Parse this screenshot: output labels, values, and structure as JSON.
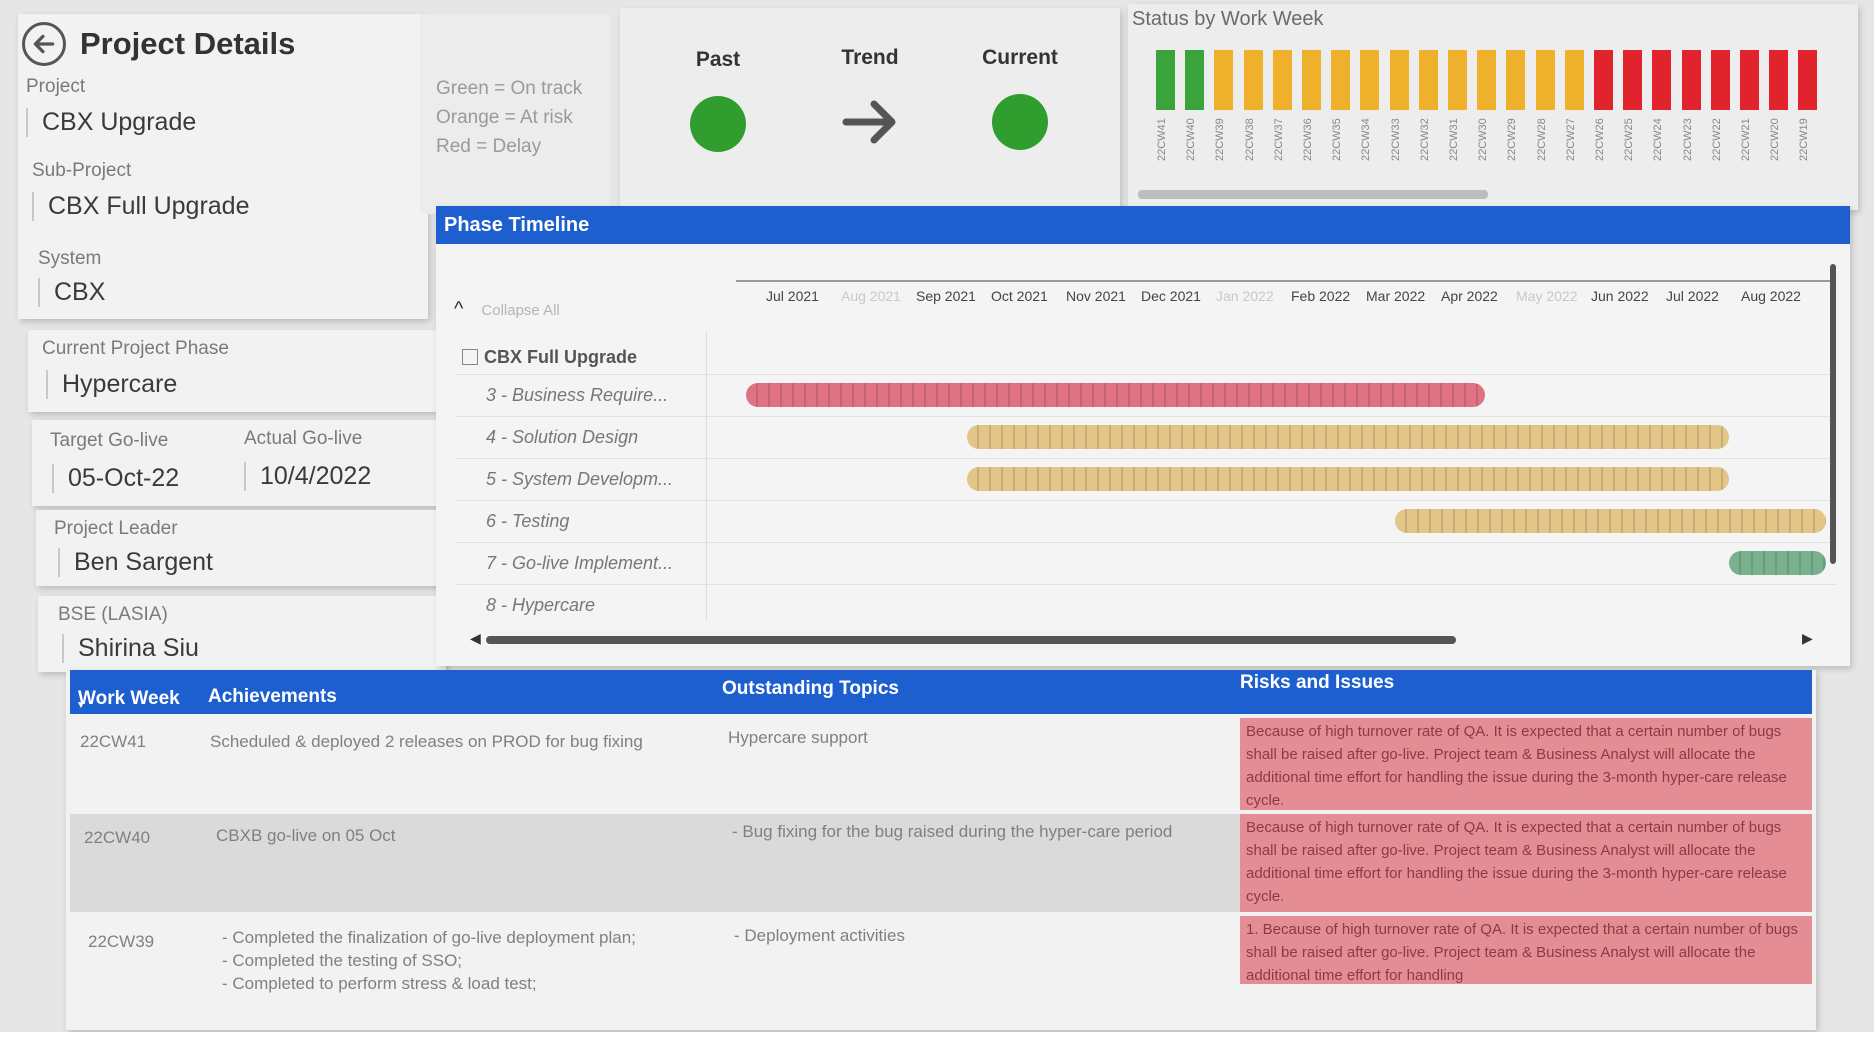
{
  "details": {
    "title": "Project Details",
    "project_label": "Project",
    "project_value": "CBX Upgrade",
    "subproject_label": "Sub-Project",
    "subproject_value": "CBX Full Upgrade",
    "system_label": "System",
    "system_value": "CBX",
    "phase_label": "Current Project Phase",
    "phase_value": "Hypercare",
    "target_label": "Target Go-live",
    "target_value": "05-Oct-22",
    "actual_label": "Actual Go-live",
    "actual_value": "10/4/2022",
    "leader_label": "Project Leader",
    "leader_value": "Ben Sargent",
    "bse_label": "BSE (LASIA)",
    "bse_value": "Shirina Siu"
  },
  "legend": {
    "green": "Green = On track",
    "orange": "Orange = At risk",
    "red": "Red = Delay"
  },
  "status": {
    "past_label": "Past",
    "trend_label": "Trend",
    "current_label": "Current",
    "past_color": "#2f9e2f",
    "current_color": "#2f9e2f",
    "trend_icon": "arrow-right-icon"
  },
  "work_week": {
    "title": "Status by Work Week",
    "colors": {
      "green": "#3aa33a",
      "orange": "#efb02c",
      "red": "#e0232d"
    },
    "weeks": [
      {
        "label": "22CW41",
        "status": "green"
      },
      {
        "label": "22CW40",
        "status": "green"
      },
      {
        "label": "22CW39",
        "status": "orange"
      },
      {
        "label": "22CW38",
        "status": "orange"
      },
      {
        "label": "22CW37",
        "status": "orange"
      },
      {
        "label": "22CW36",
        "status": "orange"
      },
      {
        "label": "22CW35",
        "status": "orange"
      },
      {
        "label": "22CW34",
        "status": "orange"
      },
      {
        "label": "22CW33",
        "status": "orange"
      },
      {
        "label": "22CW32",
        "status": "orange"
      },
      {
        "label": "22CW31",
        "status": "orange"
      },
      {
        "label": "22CW30",
        "status": "orange"
      },
      {
        "label": "22CW29",
        "status": "orange"
      },
      {
        "label": "22CW28",
        "status": "orange"
      },
      {
        "label": "22CW27",
        "status": "orange"
      },
      {
        "label": "22CW26",
        "status": "red"
      },
      {
        "label": "22CW25",
        "status": "red"
      },
      {
        "label": "22CW24",
        "status": "red"
      },
      {
        "label": "22CW23",
        "status": "red"
      },
      {
        "label": "22CW22",
        "status": "red"
      },
      {
        "label": "22CW21",
        "status": "red"
      },
      {
        "label": "22CW20",
        "status": "red"
      },
      {
        "label": "22CW19",
        "status": "red"
      }
    ]
  },
  "timeline": {
    "header": "Phase Timeline",
    "collapse_label": "Collapse All",
    "months": [
      {
        "label": "Jul 2021",
        "faint": false
      },
      {
        "label": "Aug 2021",
        "faint": true
      },
      {
        "label": "Sep 2021",
        "faint": false
      },
      {
        "label": "Oct 2021",
        "faint": false
      },
      {
        "label": "Nov 2021",
        "faint": false
      },
      {
        "label": "Dec 2021",
        "faint": false
      },
      {
        "label": "Jan 2022",
        "faint": true
      },
      {
        "label": "Feb 2022",
        "faint": false
      },
      {
        "label": "Mar 2022",
        "faint": false
      },
      {
        "label": "Apr 2022",
        "faint": false
      },
      {
        "label": "May 2022",
        "faint": true
      },
      {
        "label": "Jun 2022",
        "faint": false
      },
      {
        "label": "Jul 2022",
        "faint": false
      },
      {
        "label": "Aug 2022",
        "faint": false
      }
    ],
    "group": "CBX Full Upgrade",
    "phases": [
      {
        "label": "3 - Business Require...",
        "start": 0.0,
        "end": 9.85,
        "color": "#df7384"
      },
      {
        "label": "4 - Solution Design",
        "start": 2.95,
        "end": 13.1,
        "color": "#e3c588"
      },
      {
        "label": "5 - System Developm...",
        "start": 2.95,
        "end": 13.1,
        "color": "#e3c588"
      },
      {
        "label": "6 - Testing",
        "start": 8.65,
        "end": 14.4,
        "color": "#e3c588"
      },
      {
        "label": "7 - Go-live Implement...",
        "start": 13.1,
        "end": 14.4,
        "color": "#79b08d"
      },
      {
        "label": "8 - Hypercare",
        "start": null,
        "end": null,
        "color": null
      }
    ]
  },
  "table": {
    "headers": {
      "week": "Work Week",
      "achievements": "Achievements",
      "outstanding": "Outstanding Topics",
      "risks": "Risks and Issues"
    },
    "rows": [
      {
        "week": "22CW41",
        "achievements": "Scheduled & deployed 2 releases on PROD for bug fixing",
        "outstanding": "Hypercare support",
        "risks": "Because of high turnover rate of QA. It is expected that a certain number of bugs shall be raised after go-live. Project team & Business Analyst will allocate the additional time effort for handling the issue during the 3-month hyper-care release cycle."
      },
      {
        "week": "22CW40",
        "achievements": "CBXB go-live on 05 Oct",
        "outstanding": "- Bug fixing for the bug raised during the hyper-care period",
        "risks": "Because of high turnover rate of QA. It is expected that a certain number of bugs shall be raised after go-live. Project team & Business Analyst will allocate the additional time effort for handling the issue during the 3-month hyper-care release cycle."
      },
      {
        "week": "22CW39",
        "achievements": "- Completed the finalization of go-live deployment plan;\n- Completed the testing of SSO;\n- Completed to perform stress & load test;",
        "outstanding": "- Deployment activities",
        "risks": "1. Because of high turnover rate of QA. It is expected that a certain number of bugs shall be raised after go-live. Project team & Business Analyst will allocate the additional time effort for handling"
      }
    ]
  }
}
